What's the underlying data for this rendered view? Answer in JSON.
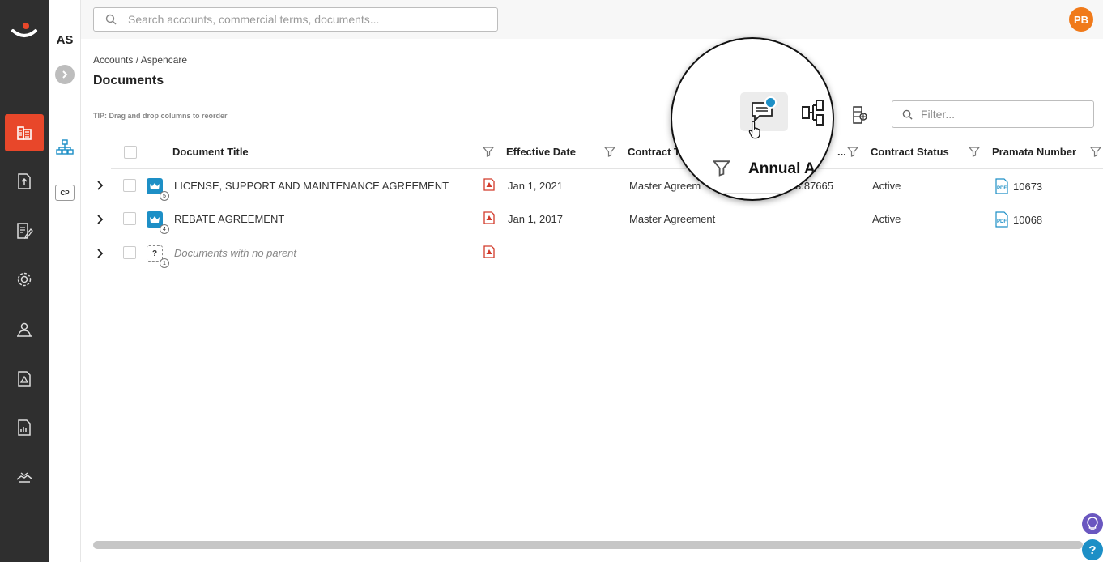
{
  "sidebar": {
    "account_abbr": "AS",
    "cp_label": "CP",
    "items": [
      {
        "icon": "logo"
      },
      {
        "icon": "accounts-building-icon",
        "active": true
      },
      {
        "icon": "upload-document-icon"
      },
      {
        "icon": "edit-document-icon"
      },
      {
        "icon": "settings-gear-icon"
      },
      {
        "icon": "user-desk-icon"
      },
      {
        "icon": "alert-document-icon"
      },
      {
        "icon": "report-document-icon"
      },
      {
        "icon": "handshake-icon"
      }
    ]
  },
  "search": {
    "placeholder": "Search accounts, commercial terms, documents..."
  },
  "user": {
    "initials": "PB",
    "color": "#f07a1a"
  },
  "breadcrumb": "Accounts / Aspencare",
  "page_title": "Documents",
  "tip": "TIP: Drag and drop columns to reorder",
  "filter": {
    "placeholder": "Filter..."
  },
  "magnifier": {
    "label": "Annual A"
  },
  "columns": [
    {
      "label": "Document Title"
    },
    {
      "label": "Effective Date"
    },
    {
      "label": "Contract T"
    },
    {
      "label": "..."
    },
    {
      "label": "Contract Status"
    },
    {
      "label": "Pramata Number"
    }
  ],
  "rows": [
    {
      "title": "LICENSE, SUPPORT AND MAINTENANCE AGREEMENT",
      "badge": "5",
      "effective_date": "Jan 1, 2021",
      "contract_type": "Master Agreem",
      "annual": "3.87665",
      "status": "Active",
      "pramata_number": "10673"
    },
    {
      "title": "REBATE AGREEMENT",
      "badge": "4",
      "effective_date": "Jan 1, 2017",
      "contract_type": "Master Agreement",
      "annual": "",
      "status": "Active",
      "pramata_number": "10068"
    },
    {
      "title": "Documents with no parent",
      "badge": "1",
      "effective_date": "",
      "contract_type": "",
      "annual": "",
      "status": "",
      "pramata_number": ""
    }
  ],
  "colors": {
    "accent": "#e8472a",
    "brand_blue": "#1d8fc6",
    "nav_bg": "#2f2f2f"
  }
}
